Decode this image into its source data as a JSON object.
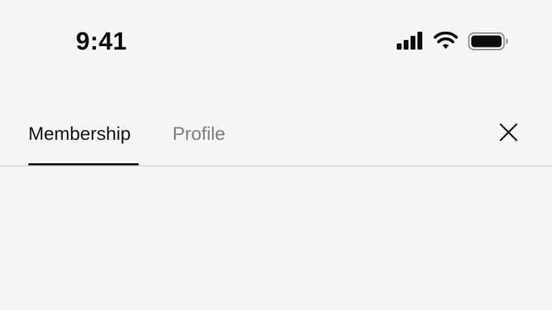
{
  "status_bar": {
    "time": "9:41",
    "icons": [
      "cellular-signal-icon",
      "wifi-icon",
      "battery-icon"
    ]
  },
  "tabs": [
    {
      "label": "Membership",
      "active": true
    },
    {
      "label": "Profile",
      "active": false
    }
  ],
  "header": {
    "close_icon": "close-icon"
  },
  "colors": {
    "background": "#f6f5f3",
    "active_tab_text": "#141414",
    "inactive_tab_text": "#7b7b7b",
    "indicator": "#0d0d0d",
    "divider": "#dddcda"
  }
}
